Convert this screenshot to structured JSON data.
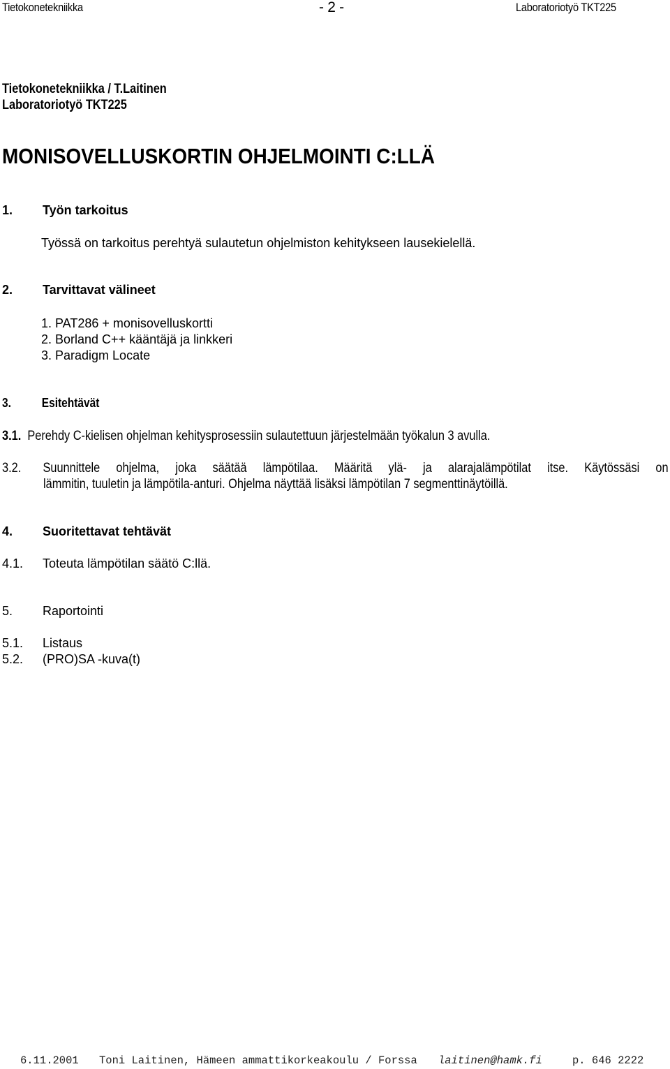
{
  "running_header": {
    "left": "Tietokonetekniikka",
    "center": "- 2 -",
    "right": "Laboratoriotyö TKT225"
  },
  "doc_header": {
    "line1": "Tietokonetekniikka / T.Laitinen",
    "line2": "Laboratoriotyö  TKT225"
  },
  "title": "MONISOVELLUSKORTIN OHJELMOINTI C:LLÄ",
  "sections": {
    "s1": {
      "number": "1.",
      "heading": "Työn tarkoitus",
      "text": "Työssä on tarkoitus perehtyä sulautetun ohjelmiston kehitykseen lausekielellä."
    },
    "s2": {
      "number": "2.",
      "heading": "Tarvittavat välineet",
      "items": [
        "1. PAT286 + monisovelluskortti",
        "2. Borland C++ kääntäjä ja linkkeri",
        "3. Paradigm Locate"
      ]
    },
    "s3": {
      "number": "3.",
      "heading": "Esitehtävät",
      "sub1_number": "3.1.",
      "sub1_text": "Perehdy C-kielisen ohjelman kehitysprosessiin sulautettuun järjestelmään työkalun 3 avulla.",
      "sub2_number": "3.2.",
      "sub2_line1": "Suunnittele ohjelma, joka säätää lämpötilaa. Määritä ylä- ja alarajalämpötilat itse. Käytössäsi on",
      "sub2_line2": "lämmitin, tuuletin ja lämpötila-anturi. Ohjelma näyttää lisäksi lämpötilan 7 segmenttinäytöillä."
    },
    "s4": {
      "number": "4.",
      "heading": "Suoritettavat tehtävät",
      "sub1_number": "4.1.",
      "sub1_text": "Toteuta lämpötilan säätö C:llä."
    },
    "s5": {
      "number": "5.",
      "heading": "Raportointi",
      "sub1_number": "5.1.",
      "sub1_text": "Listaus",
      "sub2_number": "5.2.",
      "sub2_text": "(PRO)SA -kuva(t)"
    }
  },
  "footer": {
    "date": "6.11.2001",
    "author": "Toni Laitinen, Hämeen ammattikorkeakoulu / Forssa",
    "email": "laitinen@hamk.fi",
    "phone": "p. 646 2222"
  }
}
